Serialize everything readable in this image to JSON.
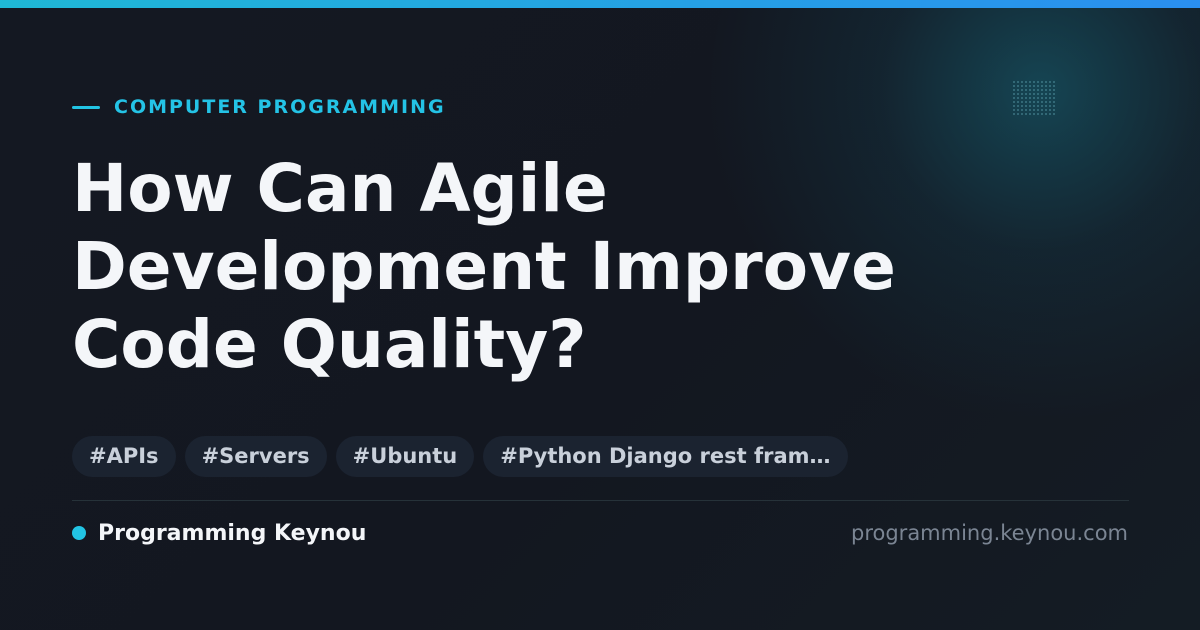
{
  "category": "COMPUTER PROGRAMMING",
  "title": "How Can Agile Development Improve Code Quality?",
  "tags": [
    "#APIs",
    "#Servers",
    "#Ubuntu",
    "#Python Django rest fram…"
  ],
  "brand": {
    "name": "Programming Keynou",
    "url": "programming.keynou.com"
  },
  "colors": {
    "accent": "#22c4e4",
    "background": "#121620",
    "title": "#f4f6f9",
    "tag_background": "#1b2330"
  }
}
